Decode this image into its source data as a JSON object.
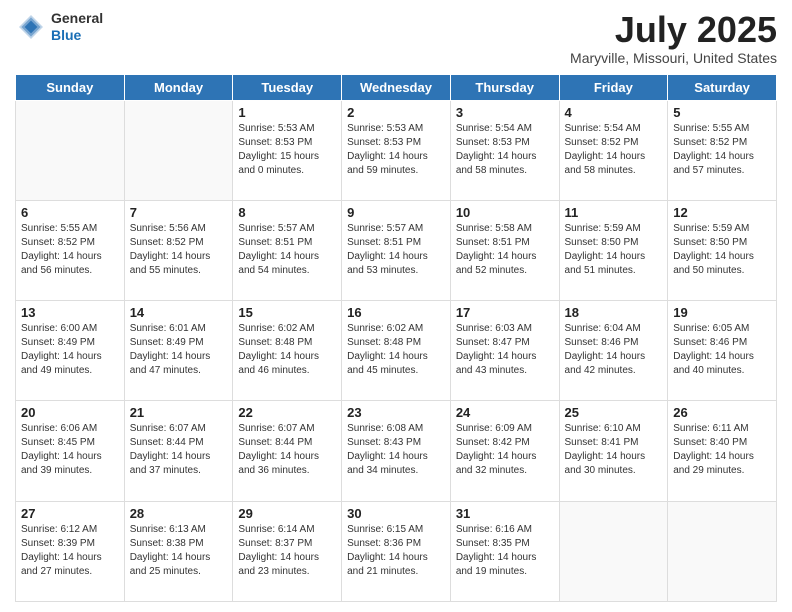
{
  "header": {
    "logo": {
      "general": "General",
      "blue": "Blue"
    },
    "title": "July 2025",
    "location": "Maryville, Missouri, United States"
  },
  "weekdays": [
    "Sunday",
    "Monday",
    "Tuesday",
    "Wednesday",
    "Thursday",
    "Friday",
    "Saturday"
  ],
  "weeks": [
    [
      {
        "day": "",
        "empty": true
      },
      {
        "day": "",
        "empty": true
      },
      {
        "day": "1",
        "sunrise": "5:53 AM",
        "sunset": "8:53 PM",
        "daylight": "15 hours and 0 minutes."
      },
      {
        "day": "2",
        "sunrise": "5:53 AM",
        "sunset": "8:53 PM",
        "daylight": "14 hours and 59 minutes."
      },
      {
        "day": "3",
        "sunrise": "5:54 AM",
        "sunset": "8:53 PM",
        "daylight": "14 hours and 58 minutes."
      },
      {
        "day": "4",
        "sunrise": "5:54 AM",
        "sunset": "8:52 PM",
        "daylight": "14 hours and 58 minutes."
      },
      {
        "day": "5",
        "sunrise": "5:55 AM",
        "sunset": "8:52 PM",
        "daylight": "14 hours and 57 minutes."
      }
    ],
    [
      {
        "day": "6",
        "sunrise": "5:55 AM",
        "sunset": "8:52 PM",
        "daylight": "14 hours and 56 minutes."
      },
      {
        "day": "7",
        "sunrise": "5:56 AM",
        "sunset": "8:52 PM",
        "daylight": "14 hours and 55 minutes."
      },
      {
        "day": "8",
        "sunrise": "5:57 AM",
        "sunset": "8:51 PM",
        "daylight": "14 hours and 54 minutes."
      },
      {
        "day": "9",
        "sunrise": "5:57 AM",
        "sunset": "8:51 PM",
        "daylight": "14 hours and 53 minutes."
      },
      {
        "day": "10",
        "sunrise": "5:58 AM",
        "sunset": "8:51 PM",
        "daylight": "14 hours and 52 minutes."
      },
      {
        "day": "11",
        "sunrise": "5:59 AM",
        "sunset": "8:50 PM",
        "daylight": "14 hours and 51 minutes."
      },
      {
        "day": "12",
        "sunrise": "5:59 AM",
        "sunset": "8:50 PM",
        "daylight": "14 hours and 50 minutes."
      }
    ],
    [
      {
        "day": "13",
        "sunrise": "6:00 AM",
        "sunset": "8:49 PM",
        "daylight": "14 hours and 49 minutes."
      },
      {
        "day": "14",
        "sunrise": "6:01 AM",
        "sunset": "8:49 PM",
        "daylight": "14 hours and 47 minutes."
      },
      {
        "day": "15",
        "sunrise": "6:02 AM",
        "sunset": "8:48 PM",
        "daylight": "14 hours and 46 minutes."
      },
      {
        "day": "16",
        "sunrise": "6:02 AM",
        "sunset": "8:48 PM",
        "daylight": "14 hours and 45 minutes."
      },
      {
        "day": "17",
        "sunrise": "6:03 AM",
        "sunset": "8:47 PM",
        "daylight": "14 hours and 43 minutes."
      },
      {
        "day": "18",
        "sunrise": "6:04 AM",
        "sunset": "8:46 PM",
        "daylight": "14 hours and 42 minutes."
      },
      {
        "day": "19",
        "sunrise": "6:05 AM",
        "sunset": "8:46 PM",
        "daylight": "14 hours and 40 minutes."
      }
    ],
    [
      {
        "day": "20",
        "sunrise": "6:06 AM",
        "sunset": "8:45 PM",
        "daylight": "14 hours and 39 minutes."
      },
      {
        "day": "21",
        "sunrise": "6:07 AM",
        "sunset": "8:44 PM",
        "daylight": "14 hours and 37 minutes."
      },
      {
        "day": "22",
        "sunrise": "6:07 AM",
        "sunset": "8:44 PM",
        "daylight": "14 hours and 36 minutes."
      },
      {
        "day": "23",
        "sunrise": "6:08 AM",
        "sunset": "8:43 PM",
        "daylight": "14 hours and 34 minutes."
      },
      {
        "day": "24",
        "sunrise": "6:09 AM",
        "sunset": "8:42 PM",
        "daylight": "14 hours and 32 minutes."
      },
      {
        "day": "25",
        "sunrise": "6:10 AM",
        "sunset": "8:41 PM",
        "daylight": "14 hours and 30 minutes."
      },
      {
        "day": "26",
        "sunrise": "6:11 AM",
        "sunset": "8:40 PM",
        "daylight": "14 hours and 29 minutes."
      }
    ],
    [
      {
        "day": "27",
        "sunrise": "6:12 AM",
        "sunset": "8:39 PM",
        "daylight": "14 hours and 27 minutes."
      },
      {
        "day": "28",
        "sunrise": "6:13 AM",
        "sunset": "8:38 PM",
        "daylight": "14 hours and 25 minutes."
      },
      {
        "day": "29",
        "sunrise": "6:14 AM",
        "sunset": "8:37 PM",
        "daylight": "14 hours and 23 minutes."
      },
      {
        "day": "30",
        "sunrise": "6:15 AM",
        "sunset": "8:36 PM",
        "daylight": "14 hours and 21 minutes."
      },
      {
        "day": "31",
        "sunrise": "6:16 AM",
        "sunset": "8:35 PM",
        "daylight": "14 hours and 19 minutes."
      },
      {
        "day": "",
        "empty": true
      },
      {
        "day": "",
        "empty": true
      }
    ]
  ]
}
